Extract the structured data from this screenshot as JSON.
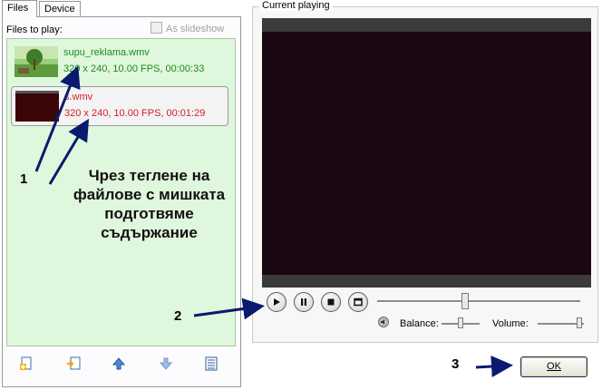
{
  "tabs": [
    {
      "label": "Files"
    },
    {
      "label": "Device"
    }
  ],
  "files_panel": {
    "files_label": "Files to play:",
    "slideshow_label": "As slideshow",
    "items": [
      {
        "name": "supu_reklama.wmv",
        "info": "320 x 240, 10.00 FPS, 00:00:33",
        "color": "#1e8a1e"
      },
      {
        "name": "s.wmv",
        "info": "320 x 240, 10.00 FPS, 00:01:29",
        "color": "#d0202a"
      }
    ],
    "toolbar_icons": [
      "add-file-icon",
      "insert-file-icon",
      "move-up-icon",
      "move-down-icon",
      "list-icon"
    ]
  },
  "player": {
    "group_title": "Current playing",
    "balance_label": "Balance:",
    "volume_label": "Volume:",
    "position_fraction": 0.43,
    "balance_fraction": 0.5,
    "volume_fraction": 0.95
  },
  "ok_label": "OK",
  "annotations": {
    "label_1": "1",
    "label_2": "2",
    "label_3": "3",
    "text": "Чрез теглене на файлове с мишката подготвяме съдържание",
    "arrow_color": "#0a1a6e"
  }
}
